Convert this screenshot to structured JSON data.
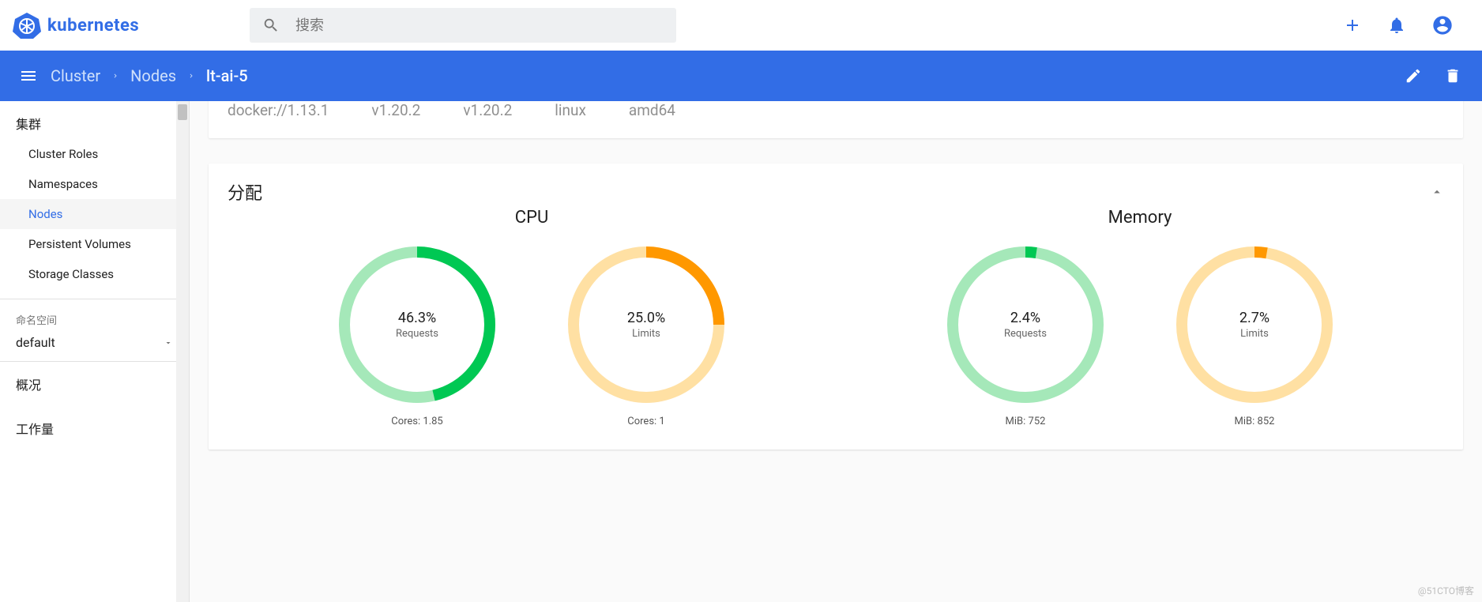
{
  "brand": {
    "name": "kubernetes"
  },
  "search": {
    "placeholder": "搜索"
  },
  "breadcrumb": {
    "cluster": "Cluster",
    "nodes": "Nodes",
    "current": "lt-ai-5"
  },
  "sidebar": {
    "group_cluster": "集群",
    "items": [
      {
        "label": "Cluster Roles"
      },
      {
        "label": "Namespaces"
      },
      {
        "label": "Nodes"
      },
      {
        "label": "Persistent Volumes"
      },
      {
        "label": "Storage Classes"
      }
    ],
    "ns_label": "命名空间",
    "ns_selected": "default",
    "overview": "概况",
    "workloads": "工作量"
  },
  "info_row": {
    "runtime": "docker://1.13.1",
    "kubelet": "v1.20.2",
    "kubeproxy": "v1.20.2",
    "os": "linux",
    "arch": "amd64"
  },
  "allocation": {
    "title": "分配",
    "cpu_title": "CPU",
    "memory_title": "Memory",
    "cpu": {
      "requests": {
        "percent": "46.3%",
        "label": "Requests",
        "footer": "Cores: 1.85",
        "value_fraction": 0.463
      },
      "limits": {
        "percent": "25.0%",
        "label": "Limits",
        "footer": "Cores: 1",
        "value_fraction": 0.25
      }
    },
    "memory": {
      "requests": {
        "percent": "2.4%",
        "label": "Requests",
        "footer": "MiB: 752",
        "value_fraction": 0.024
      },
      "limits": {
        "percent": "2.7%",
        "label": "Limits",
        "footer": "MiB: 852",
        "value_fraction": 0.027
      }
    }
  },
  "colors": {
    "green_fg": "#00c853",
    "green_bg": "#a5e8b9",
    "orange_fg": "#ff9800",
    "orange_bg": "#ffe0a3"
  },
  "chart_data": [
    {
      "type": "pie",
      "title": "CPU Requests",
      "series": [
        {
          "name": "Requests",
          "values": [
            46.3,
            53.7
          ]
        }
      ],
      "unit": "%",
      "footer": "Cores: 1.85"
    },
    {
      "type": "pie",
      "title": "CPU Limits",
      "series": [
        {
          "name": "Limits",
          "values": [
            25.0,
            75.0
          ]
        }
      ],
      "unit": "%",
      "footer": "Cores: 1"
    },
    {
      "type": "pie",
      "title": "Memory Requests",
      "series": [
        {
          "name": "Requests",
          "values": [
            2.4,
            97.6
          ]
        }
      ],
      "unit": "%",
      "footer": "MiB: 752"
    },
    {
      "type": "pie",
      "title": "Memory Limits",
      "series": [
        {
          "name": "Limits",
          "values": [
            2.7,
            97.3
          ]
        }
      ],
      "unit": "%",
      "footer": "MiB: 852"
    }
  ],
  "watermark": "@51CTO博客"
}
